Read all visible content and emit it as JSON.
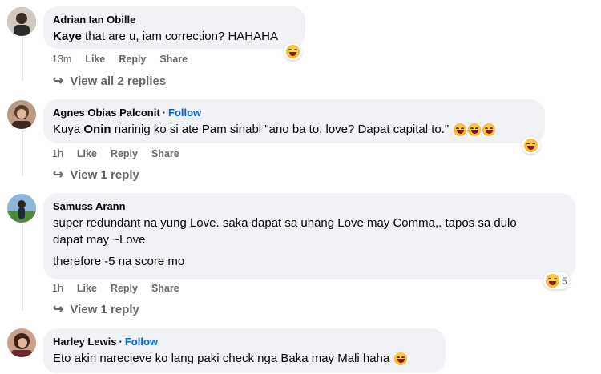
{
  "comments": [
    {
      "author": "Adrian Ian Obille",
      "mention": "Kaye",
      "text": " that are u, iam correction? HAHAHA",
      "time": "13m",
      "like": "Like",
      "reply": "Reply",
      "share": "Share",
      "replies_label": "View all 2 replies",
      "reaction_icon": "laugh-emoji",
      "avatar_color": "#6d6a63"
    },
    {
      "author": "Agnes Obias Palconit",
      "follow": "Follow",
      "mention": "Kuya Onin",
      "text_prefix": "Kuya ",
      "mention_name": "Onin",
      "text": " narinig ko si ate Pam sinabi \"ano ba to, love? Dapat capital to.\"",
      "time": "1h",
      "like": "Like",
      "reply": "Reply",
      "share": "Share",
      "replies_label": "View 1 reply",
      "reaction_icon": "laugh-emoji",
      "inline_emojis": [
        "rofl-emoji",
        "rofl-emoji",
        "rofl-emoji"
      ],
      "avatar_color": "#7a5540"
    },
    {
      "author": "Samuss Arann",
      "line1": "super redundant na yung Love. saka dapat sa unang Love may Comma,. tapos sa dulo",
      "line2": "dapat may ~Love",
      "line3": "therefore -5 na score mo",
      "time": "1h",
      "like": "Like",
      "reply": "Reply",
      "share": "Share",
      "replies_label": "View 1 reply",
      "reaction_icon": "laugh-emoji",
      "reaction_count": "5",
      "avatar_color": "#4a7aa8"
    },
    {
      "author": "Harley Lewis",
      "follow": "Follow",
      "text": "Eto akin narecieve ko lang paki check nga Baka may Mali haha",
      "inline_emojis": [
        "laugh-emoji"
      ],
      "avatar_color": "#8a4a3a"
    }
  ],
  "separator": "·"
}
